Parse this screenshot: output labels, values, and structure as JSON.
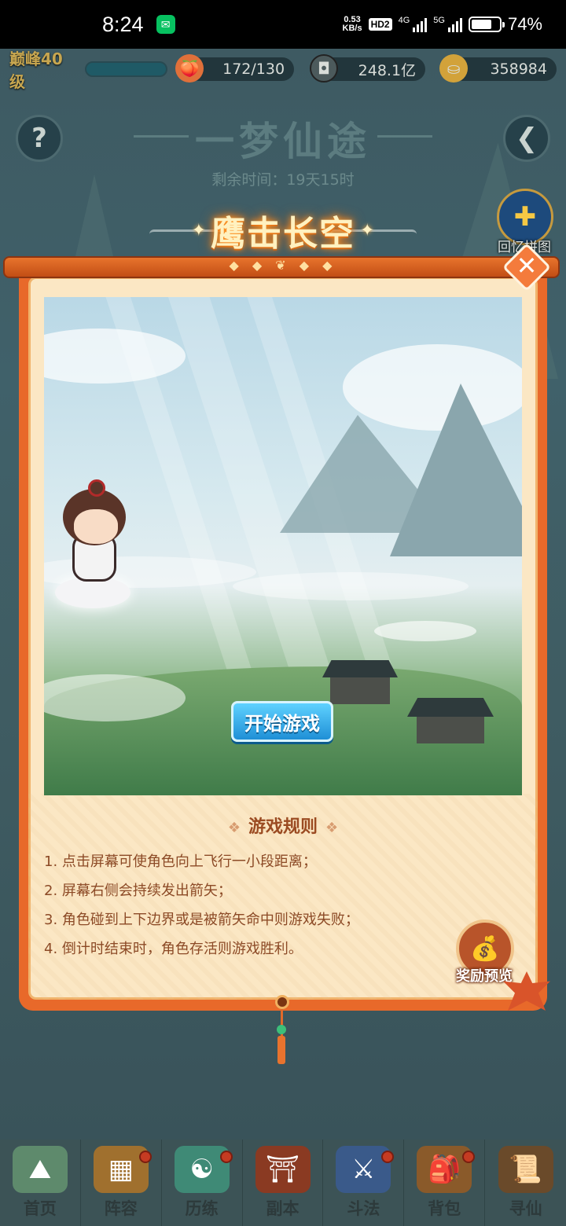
{
  "status_bar": {
    "time": "8:24",
    "speed_value": "0.53",
    "speed_unit": "KB/s",
    "hd": "HD2",
    "net1": "4G",
    "net2": "5G",
    "battery_percent": 74,
    "battery_label": "74%"
  },
  "resources": {
    "level": "巅峰40级",
    "stamina": "172/130",
    "silver": "248.1亿",
    "gold": "358984"
  },
  "header": {
    "title": "一梦仙途",
    "remaining": "剩余时间：19天15时",
    "puzzle_label": "回忆拼图"
  },
  "panel": {
    "title": "鹰击长空",
    "start_label": "开始游戏",
    "rules_title": "游戏规则",
    "rules": [
      "1. 点击屏幕可使角色向上飞行一小段距离；",
      "2. 屏幕右侧会持续发出箭矢；",
      "3. 角色碰到上下边界或是被箭矢命中则游戏失败；",
      "4. 倒计时结束时，角色存活则游戏胜利。"
    ],
    "reward_label": "奖励预览",
    "close_label": "✕"
  },
  "bottom_nav": [
    {
      "label": "首页",
      "icon": "home-icon",
      "dot": false
    },
    {
      "label": "阵容",
      "icon": "lineup-icon",
      "dot": true
    },
    {
      "label": "历练",
      "icon": "training-icon",
      "dot": true
    },
    {
      "label": "副本",
      "icon": "dungeon-icon",
      "dot": false
    },
    {
      "label": "斗法",
      "icon": "battle-icon",
      "dot": true
    },
    {
      "label": "背包",
      "icon": "bag-icon",
      "dot": true
    },
    {
      "label": "寻仙",
      "icon": "seek-icon",
      "dot": false
    }
  ],
  "colors": {
    "accent": "#e8692a",
    "panel_bg": "#fbe7c4",
    "start_button": "#1f8fd6",
    "rule_text": "#8c4a26"
  }
}
